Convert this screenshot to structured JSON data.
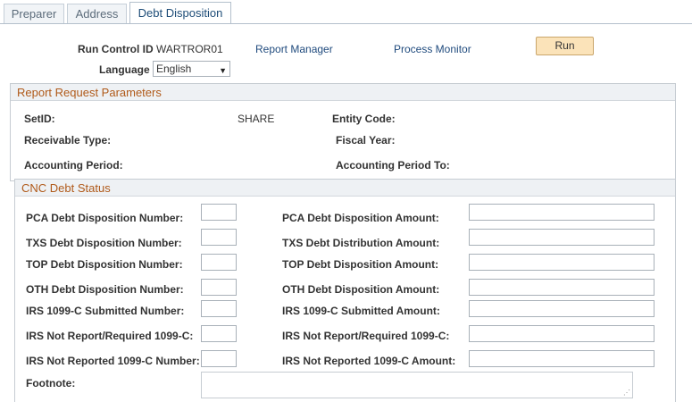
{
  "tabs": [
    {
      "label": "Preparer",
      "active": false
    },
    {
      "label": "Address",
      "active": false
    },
    {
      "label": "Debt Disposition",
      "active": true
    }
  ],
  "header": {
    "run_control_label": "Run Control ID",
    "run_control_value": "WARTROR01",
    "report_manager": "Report Manager",
    "process_monitor": "Process Monitor",
    "run_button": "Run",
    "language_label": "Language",
    "language_value": "English"
  },
  "report_params": {
    "title": "Report Request Parameters",
    "setid_label": "SetID:",
    "setid_value": "SHARE",
    "entity_code_label": "Entity Code:",
    "receivable_type_label": "Receivable Type:",
    "fiscal_year_label": "Fiscal Year:",
    "accounting_period_label": "Accounting Period:",
    "accounting_period_to_label": "Accounting Period To:"
  },
  "cnc": {
    "title": "CNC Debt Status",
    "rows": [
      {
        "left": "PCA Debt Disposition Number:",
        "right": "PCA Debt Disposition Amount:"
      },
      {
        "left": "TXS Debt Disposition Number:",
        "right": "TXS Debt Distribution Amount:"
      },
      {
        "left": "TOP Debt Disposition Number:",
        "right": "TOP Debt Disposition Amount:"
      },
      {
        "left": "OTH Debt Disposition Number:",
        "right": "OTH Debt Disposition Amount:"
      },
      {
        "left": "IRS 1099-C Submitted Number:",
        "right": "IRS 1099-C Submitted Amount:"
      },
      {
        "left": "IRS Not Report/Required 1099-C:",
        "right": "IRS Not Report/Required 1099-C:"
      },
      {
        "left": "IRS Not Reported 1099-C Number:",
        "right": "IRS Not Reported 1099-C Amount:"
      }
    ],
    "footnote_label": "Footnote:"
  }
}
